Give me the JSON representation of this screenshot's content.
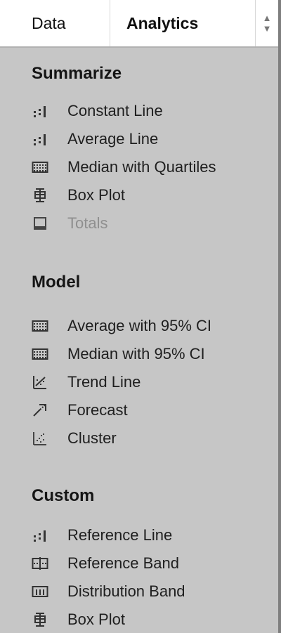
{
  "tabs": {
    "data": "Data",
    "analytics": "Analytics"
  },
  "summarize": {
    "title": "Summarize",
    "items": [
      {
        "label": "Constant Line",
        "icon": "reference-line-icon"
      },
      {
        "label": "Average Line",
        "icon": "reference-line-icon"
      },
      {
        "label": "Median with Quartiles",
        "icon": "distribution-band-icon"
      },
      {
        "label": "Box Plot",
        "icon": "box-plot-icon"
      },
      {
        "label": "Totals",
        "icon": "totals-icon",
        "disabled": true
      }
    ]
  },
  "model": {
    "title": "Model",
    "items": [
      {
        "label": "Average with 95% CI",
        "icon": "distribution-band-icon"
      },
      {
        "label": "Median with 95% CI",
        "icon": "distribution-band-icon"
      },
      {
        "label": "Trend Line",
        "icon": "trend-line-icon"
      },
      {
        "label": "Forecast",
        "icon": "forecast-icon"
      },
      {
        "label": "Cluster",
        "icon": "cluster-icon"
      }
    ]
  },
  "custom": {
    "title": "Custom",
    "items": [
      {
        "label": "Reference Line",
        "icon": "reference-line-icon"
      },
      {
        "label": "Reference Band",
        "icon": "reference-band-icon"
      },
      {
        "label": "Distribution Band",
        "icon": "distribution-band-icon"
      },
      {
        "label": "Box Plot",
        "icon": "box-plot-icon"
      }
    ]
  },
  "colors": {
    "panel_bg": "#c6c6c6",
    "tab_bg": "#ffffff",
    "text": "#1f1f1f",
    "disabled_text": "#8f8f8f",
    "right_border": "#7f7f7f"
  }
}
